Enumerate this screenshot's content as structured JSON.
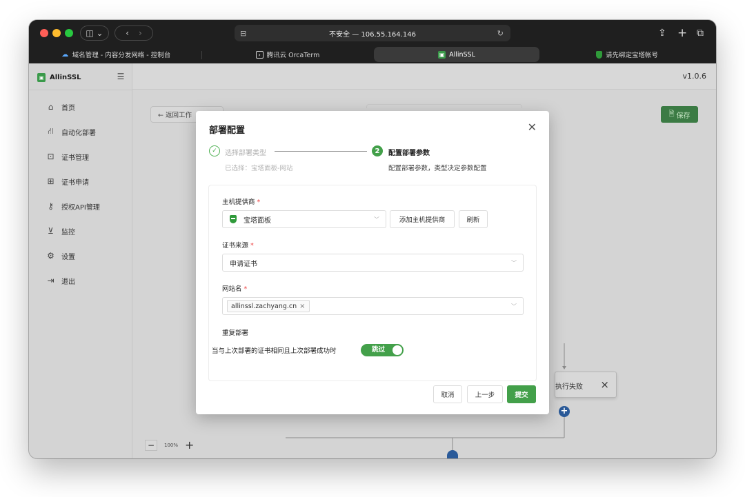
{
  "browser": {
    "address": "不安全 — 106.55.164.146",
    "tabs": [
      {
        "label": "域名管理 - 内容分发网络 - 控制台",
        "icon": "cloud-icon"
      },
      {
        "label": "腾讯云 OrcaTerm",
        "icon": "terminal-icon"
      },
      {
        "label": "AllinSSL",
        "icon": "lock-icon"
      },
      {
        "label": "请先绑定宝塔帐号",
        "icon": "baota-icon"
      }
    ]
  },
  "sidebar": {
    "brand": "AllinSSL",
    "items": [
      {
        "label": "首页",
        "icon": "home-icon"
      },
      {
        "label": "自动化部署",
        "icon": "workflow-icon"
      },
      {
        "label": "证书管理",
        "icon": "certificate-icon"
      },
      {
        "label": "证书申请",
        "icon": "plus-square-icon"
      },
      {
        "label": "授权API管理",
        "icon": "key-icon"
      },
      {
        "label": "监控",
        "icon": "monitor-icon"
      },
      {
        "label": "设置",
        "icon": "gear-icon"
      },
      {
        "label": "退出",
        "icon": "logout-icon"
      }
    ]
  },
  "header": {
    "version": "v1.0.6"
  },
  "workspace": {
    "back_label": "← 返回工作",
    "save_label": "保存",
    "fail_node_label": "执行失败",
    "zoom_level": "100%"
  },
  "modal": {
    "title": "部署配置",
    "steps": [
      {
        "index": "✓",
        "title": "选择部署类型",
        "desc": "已选择：宝塔面板-网站",
        "status": "done"
      },
      {
        "index": "2",
        "title": "配置部署参数",
        "desc": "配置部署参数，类型决定参数配置",
        "status": "active"
      }
    ],
    "form": {
      "host_provider": {
        "label": "主机提供商",
        "value": "宝塔面板",
        "add_button": "添加主机提供商",
        "refresh_button": "刷新"
      },
      "cert_source": {
        "label": "证书来源",
        "value": "申请证书"
      },
      "site_name": {
        "label": "网站名",
        "tag": "allinssl.zachyang.cn"
      },
      "redeploy": {
        "label": "重复部署",
        "desc": "当与上次部署的证书相同且上次部署成功时",
        "toggle_label": "跳过",
        "toggle_on": true
      }
    },
    "footer": {
      "cancel": "取消",
      "prev": "上一步",
      "submit": "提交"
    }
  },
  "colors": {
    "primary": "#43a04a",
    "flow_node": "#2a5a99"
  }
}
